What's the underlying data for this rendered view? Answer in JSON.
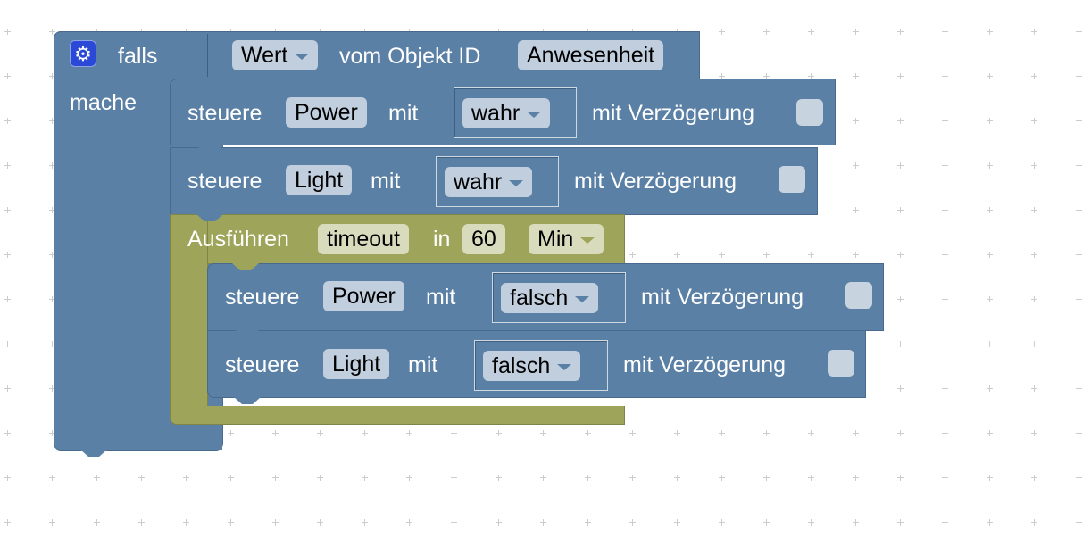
{
  "colors": {
    "control_block": "#5b80a5",
    "timeout_block": "#9ea55a",
    "gear": "#2a49d6"
  },
  "if_block": {
    "icon": "gear-icon",
    "falls": "falls",
    "mache": "mache",
    "condition": {
      "field": "Wert",
      "label": "vom Objekt ID",
      "object": "Anwesenheit"
    }
  },
  "rows": [
    {
      "steuere": "steuere",
      "object": "Power",
      "mit": "mit",
      "value": "wahr",
      "delay": "mit Verzögerung",
      "delay_checked": false
    },
    {
      "steuere": "steuere",
      "object": "Light",
      "mit": "mit",
      "value": "wahr",
      "delay": "mit Verzögerung",
      "delay_checked": false
    }
  ],
  "timeout": {
    "label": "Ausführen",
    "name": "timeout",
    "in": "in",
    "value": "60",
    "unit": "Min",
    "rows": [
      {
        "steuere": "steuere",
        "object": "Power",
        "mit": "mit",
        "value": "falsch",
        "delay": "mit Verzögerung",
        "delay_checked": false
      },
      {
        "steuere": "steuere",
        "object": "Light",
        "mit": "mit",
        "value": "falsch",
        "delay": "mit Verzögerung",
        "delay_checked": false
      }
    ]
  }
}
